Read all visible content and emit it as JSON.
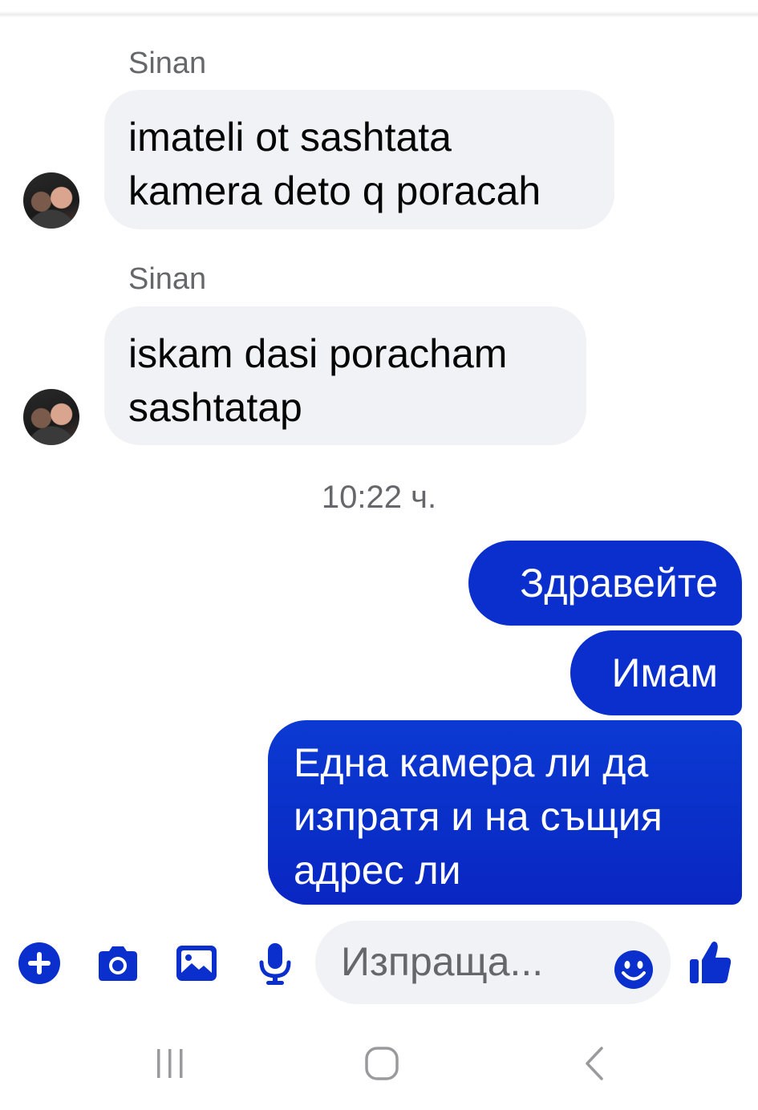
{
  "messages_incoming": [
    {
      "sender": "Sinan",
      "lines": [
        "imateli ot sashtata",
        "kamera deto q poracah"
      ]
    },
    {
      "sender": "Sinan",
      "lines": [
        "iskam dasi poracham",
        "sashtatap"
      ]
    }
  ],
  "timestamp": "10:22 ч.",
  "messages_outgoing": [
    {
      "lines": [
        "Здравейте"
      ]
    },
    {
      "lines": [
        "Имам"
      ]
    },
    {
      "lines": [
        "Една камера ли да",
        "изпратя и на същия",
        "адрес ли"
      ]
    }
  ],
  "composer": {
    "placeholder": "Изпраща..."
  },
  "colors": {
    "accent": "#0a2fcd",
    "incoming_bubble": "#f0f2f5",
    "secondary_text": "#65676b"
  },
  "icons": {
    "composer": [
      "plus-circle-icon",
      "camera-icon",
      "image-icon",
      "microphone-icon",
      "emoji-icon",
      "thumbs-up-icon"
    ],
    "navigation": [
      "recent-apps-icon",
      "home-icon",
      "back-icon"
    ]
  }
}
